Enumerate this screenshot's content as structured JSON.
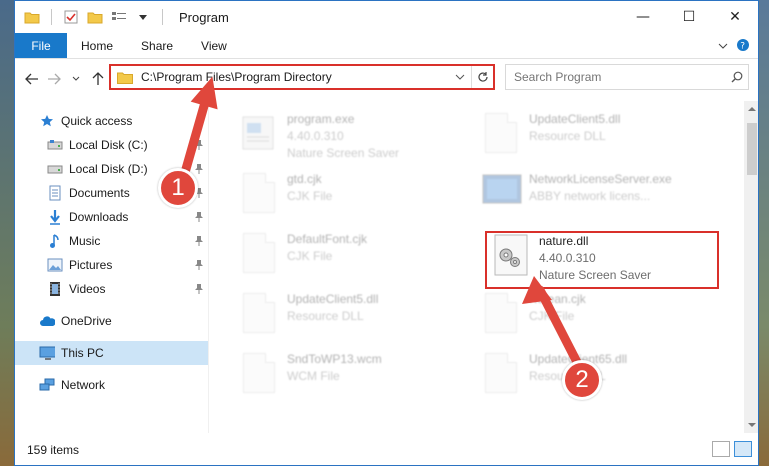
{
  "window": {
    "title": "Program",
    "controls": {
      "minimize": "—",
      "maximize": "☐",
      "close": "✕"
    }
  },
  "ribbon": {
    "tabs": [
      "File",
      "Home",
      "Share",
      "View"
    ]
  },
  "address": {
    "path": "C:\\Program Files\\Program Directory"
  },
  "search": {
    "placeholder": "Search Program"
  },
  "nav": {
    "quick_access": "Quick access",
    "items": [
      {
        "label": "Local Disk (C:)",
        "icon": "drive-icon",
        "pinned": true
      },
      {
        "label": "Local Disk (D:)",
        "icon": "drive-icon",
        "pinned": true
      },
      {
        "label": "Documents",
        "icon": "documents-icon",
        "pinned": true
      },
      {
        "label": "Downloads",
        "icon": "downloads-icon",
        "pinned": true
      },
      {
        "label": "Music",
        "icon": "music-icon",
        "pinned": true
      },
      {
        "label": "Pictures",
        "icon": "pictures-icon",
        "pinned": true
      },
      {
        "label": "Videos",
        "icon": "videos-icon",
        "pinned": true
      }
    ],
    "onedrive": "OneDrive",
    "this_pc": "This PC",
    "network": "Network"
  },
  "files": [
    {
      "name": "program.exe",
      "line2": "4.40.0.310",
      "line3": "Nature Screen Saver"
    },
    {
      "name": "UpdateClient5.dll",
      "line2": "Resource DLL",
      "line3": ""
    },
    {
      "name": "gtd.cjk",
      "line2": "CJK File",
      "line3": ""
    },
    {
      "name": "NetworkLicenseServer.exe",
      "line2": "ABBY network licens...",
      "line3": ""
    },
    {
      "name": "DefaultFont.cjk",
      "line2": "CJK File",
      "line3": ""
    },
    {
      "name": "nature.dll",
      "line2": "4.40.0.310",
      "line3": "Nature Screen Saver"
    },
    {
      "name": "UpdateClient5.dll",
      "line2": "Resource DLL",
      "line3": ""
    },
    {
      "name": "Korean.cjk",
      "line2": "CJK File",
      "line3": ""
    },
    {
      "name": "SndToWP13.wcm",
      "line2": "WCM File",
      "line3": ""
    },
    {
      "name": "UpdateClient65.dll",
      "line2": "Resource DLL",
      "line3": ""
    }
  ],
  "status": {
    "item_count": "159 items"
  },
  "annotations": {
    "step1": "1",
    "step2": "2"
  },
  "colors": {
    "accent": "#1979ca",
    "highlight": "#d9302a",
    "badge": "#e0473c",
    "selected": "#cce4f7"
  }
}
